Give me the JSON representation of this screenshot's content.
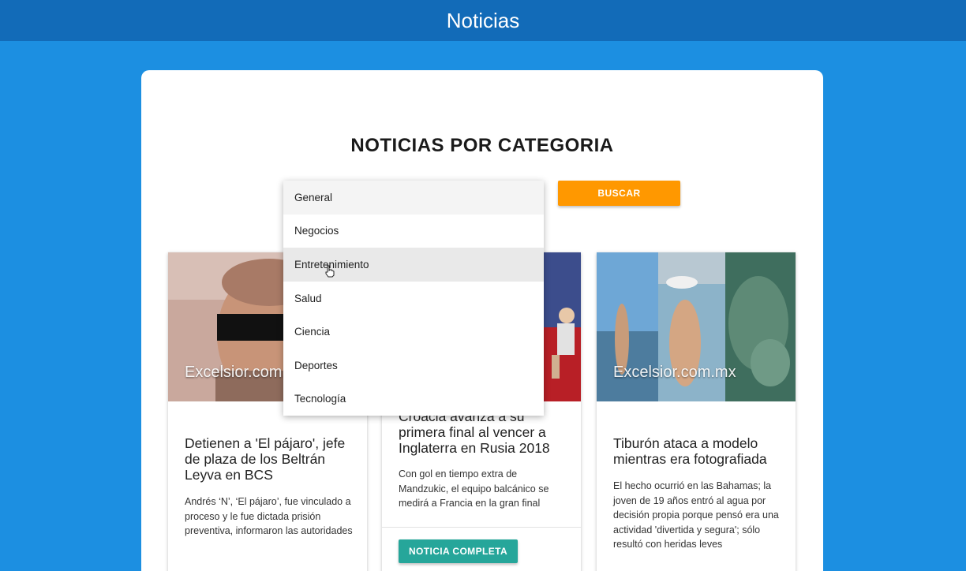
{
  "header": {
    "title": "Noticias"
  },
  "main": {
    "heading": "NOTICIAS POR CATEGORIA",
    "category_select": {
      "options": [
        "General",
        "Negocios",
        "Entretenimiento",
        "Salud",
        "Ciencia",
        "Deportes",
        "Tecnología"
      ],
      "selected": "General",
      "hovered": "Entretenimiento"
    },
    "search_label": "BUSCAR",
    "cards": [
      {
        "image_watermark": "Excelsior.com.mx",
        "title": "Detienen a 'El pájaro', jefe de plaza de los Beltrán Leyva en BCS",
        "description": "Andrés ‘N’, ‘El pájaro’, fue vinculado a proceso y le fue dictada prisión preventiva, informaron las autoridades"
      },
      {
        "title": "Croacia avanza a su primera final al vencer a Inglaterra en Rusia 2018",
        "description": "Con gol en tiempo extra de Mandzukic, el equipo balcánico se medirá a Francia en la gran final",
        "button_label": "NOTICIA COMPLETA"
      },
      {
        "image_watermark": "Excelsior.com.mx",
        "title": "Tiburón ataca a modelo mientras era fotografiada",
        "description": "El hecho ocurrió en las Bahamas; la joven de 19 años entró al agua por decisión propia porque pensó era una actividad 'divertida y segura'; sólo resultó con heridas leves"
      }
    ]
  },
  "colors": {
    "background": "#1c8fe1",
    "header": "#126bb8",
    "search_button": "#ff9800",
    "card_button": "#26a69a"
  }
}
